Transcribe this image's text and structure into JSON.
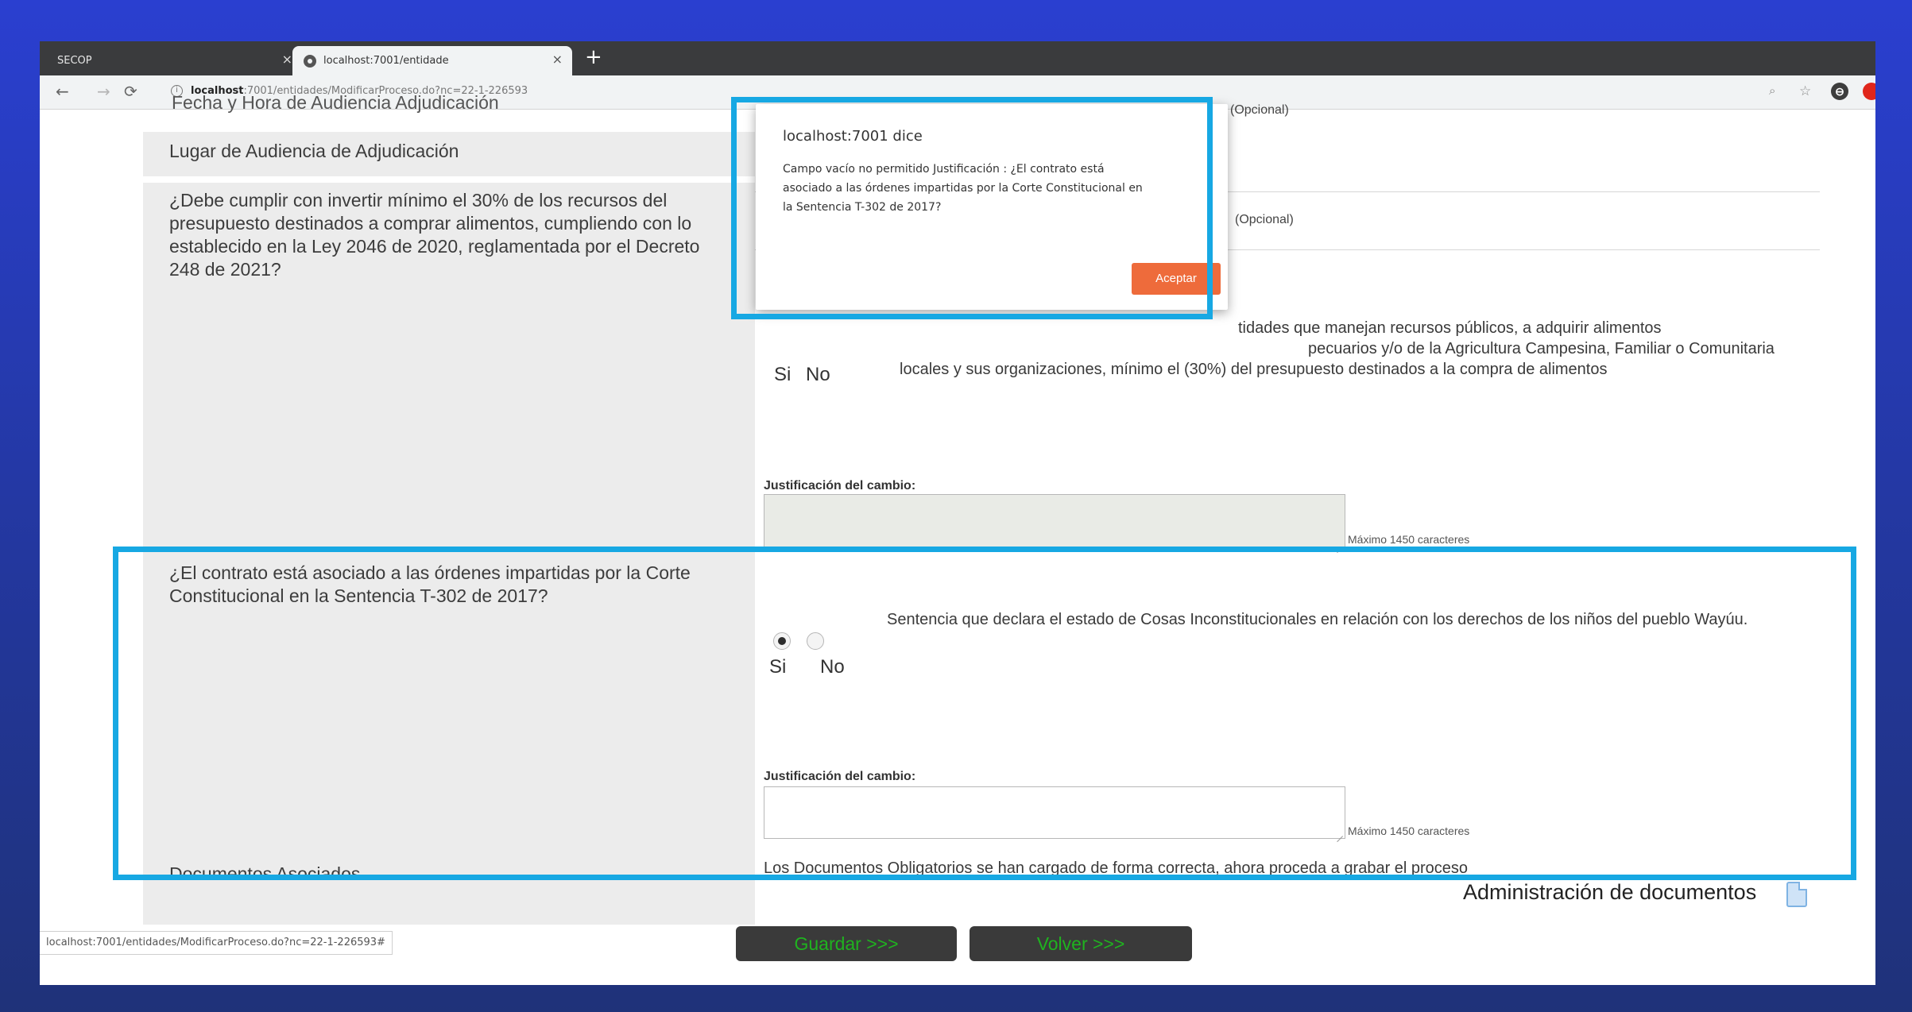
{
  "browser": {
    "tab_inactive": "SECOP",
    "tab_active": "localhost:7001/entidade",
    "url_host": "localhost",
    "url_rest": ":7001/entidades/ModificarProceso.do?nc=22-1-226593",
    "status_url": "localhost:7001/entidades/ModificarProceso.do?nc=22-1-226593#"
  },
  "form": {
    "faded_title": "Fecha y Hora de Audiencia Adjudicación",
    "opcional": "(Opcional)",
    "lugar_label": "Lugar de Audiencia de Adjudicación",
    "q1": {
      "label": "¿Debe cumplir con invertir mínimo el 30% de los recursos del presupuesto destinados a comprar alimentos, cumpliendo con lo establecido en la Ley 2046 de 2020, reglamentada por el Decreto 248 de 2021?",
      "desc": "tidades que manejan recursos públicos, a adquirir alimentos",
      "desc2_partial": "pecuarios y/o de la Agricultura Campesina, Familiar o Comunitaria",
      "desc3_partial": "locales y sus organizaciones, mínimo el (30%) del presupuesto destinados a la compra de alimentos",
      "si": "Si",
      "no": "No",
      "just_label": "Justificación del cambio:",
      "max_label": "Máximo 1450 caracteres"
    },
    "q2": {
      "label": "¿El contrato está asociado a las órdenes impartidas por la Corte Constitucional en la Sentencia T-302 de 2017?",
      "desc": "Sentencia que declara el estado de Cosas Inconstitucionales en relación con los derechos de los niños del pueblo Wayúu.",
      "si": "Si",
      "no": "No",
      "just_label": "Justificación del cambio:",
      "max_label": "Máximo 1450 caracteres"
    },
    "docs": {
      "label": "Documentos Asociados",
      "text": "Los Documentos Obligatorios se han cargado de forma correcta, ahora proceda a grabar el proceso",
      "admin": "Administración de documentos"
    },
    "buttons": {
      "guardar": "Guardar >>>",
      "volver": "Volver >>>"
    }
  },
  "dialog": {
    "title": "localhost:7001 dice",
    "message": "Campo vacío no permitido Justificación : ¿El contrato está asociado a las órdenes impartidas por la Corte Constitucional en la Sentencia T-302 de 2017?",
    "button": "Aceptar"
  },
  "colors": {
    "highlight": "#17a8e3",
    "dialog_button": "#ee6b3b",
    "button_text": "#1fb31f"
  }
}
